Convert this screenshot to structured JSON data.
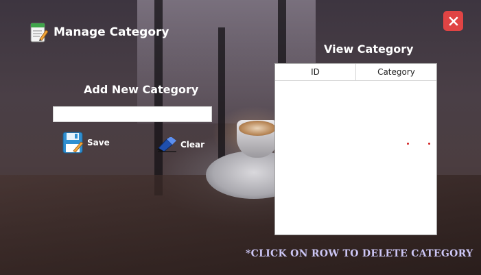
{
  "window": {
    "title": "Manage Category"
  },
  "add_section": {
    "heading": "Add New Category",
    "input_value": "",
    "save_label": "Save",
    "clear_label": "Clear"
  },
  "view_section": {
    "heading": "View Category",
    "columns": [
      "ID",
      "Category"
    ],
    "rows": []
  },
  "footer": {
    "note": "*CLICK ON ROW TO DELETE CATEGORY"
  },
  "colors": {
    "close_button": "#e04444",
    "footer_text": "#ccc6f5",
    "heading_text": "#ffffff"
  },
  "icons": {
    "title": "notepad-pencil-icon",
    "close": "close-icon",
    "save": "floppy-disk-icon",
    "clear": "eraser-icon"
  }
}
